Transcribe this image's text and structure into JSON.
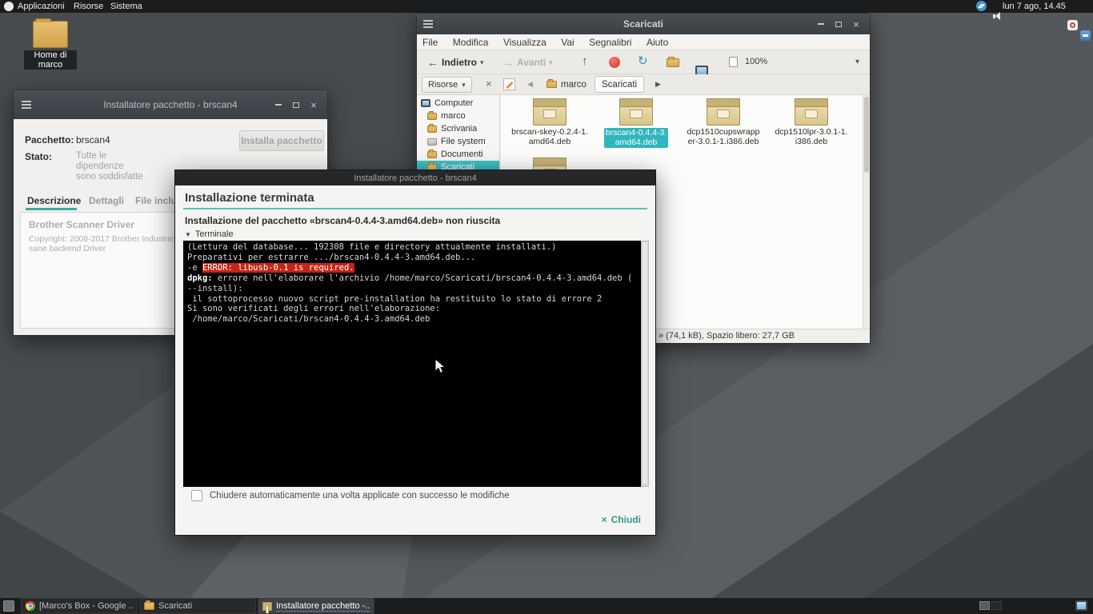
{
  "icons": {
    "back": "←",
    "forward": "→",
    "up": "↑",
    "refresh": "↻",
    "caret": "▾",
    "prev": "◀",
    "next": "▶",
    "expander": "▼",
    "close": "×"
  },
  "top_panel": {
    "menus": [
      "Applicazioni",
      "Risorse",
      "Sistema"
    ],
    "clock": "lun 7 ago, 14.45"
  },
  "desktop": {
    "home_label": "Home di marco"
  },
  "fm": {
    "title": "Scaricati",
    "menus": [
      "File",
      "Modifica",
      "Visualizza",
      "Vai",
      "Segnalibri",
      "Aiuto"
    ],
    "toolbar": {
      "back": "Indietro",
      "forward": "Avanti",
      "zoom": "100%"
    },
    "pathbar": {
      "places": "Risorse",
      "folder": "marco",
      "current": "Scaricati"
    },
    "sidebar": {
      "root": "Computer",
      "items": [
        "marco",
        "Scrivania",
        "File system",
        "Documenti",
        "Scaricati"
      ]
    },
    "files": [
      {
        "line1": "brscan-skey-0.2.4-1.",
        "line2": "amd64.deb"
      },
      {
        "line1": "brscan4-0.4.4-3.",
        "line2": "amd64.deb"
      },
      {
        "line1": "dcp1510cupswrapp",
        "line2": "er-3.0.1-1.i386.deb"
      },
      {
        "line1": "dcp1510lpr-3.0.1-1.",
        "line2": "i386.deb"
      }
    ],
    "status": "» (74,1 kB), Spazio libero: 27,7 GB"
  },
  "inst": {
    "title": "Installatore pacchetto - brscan4",
    "package_label": "Pacchetto:",
    "package_value": "brscan4",
    "install_button": "Installa pacchetto",
    "status_label": "Stato:",
    "status_value": "Tutte le dipendenze sono soddisfatte",
    "tabs": [
      "Descrizione",
      "Dettagli",
      "File inclusi"
    ],
    "desc_title": "Brother Scanner Driver",
    "desc_copyright": "Copyright: 2008-2017 Brother Industries,",
    "desc_line": "sane backend Driver"
  },
  "dlg": {
    "title": "Installatore pacchetto - brscan4",
    "heading": "Installazione terminata",
    "message": "Installazione del pacchetto «brscan4-0.4.4-3.amd64.deb» non riuscita",
    "terminal_label": "Terminale",
    "term": {
      "l1": "(Lettura del database... 192308 file e directory attualmente installati.)",
      "l2": "Preparativi per estrarre .../brscan4-0.4.4-3.amd64.deb...",
      "l3_prefix": "-e ",
      "l3_error": "ERROR: libusb-0.1 is required.",
      "l4_bold": "dpkg:",
      "l4_rest": " errore nell'elaborare l'archivio /home/marco/Scaricati/brscan4-0.4.4-3.amd64.deb (",
      "l5": "--install):",
      "l6": " il sottoprocesso nuovo script pre-installation ha restituito lo stato di errore 2",
      "l7": "Si sono verificati degli errori nell'elaborazione:",
      "l8": " /home/marco/Scaricati/brscan4-0.4.4-3.amd64.deb"
    },
    "checkbox_label": "Chiudere automaticamente una volta applicate con successo le modifiche",
    "close_label": "Chiudi"
  },
  "taskbar": {
    "windows": [
      {
        "title": "[Marco's Box - Google ..."
      },
      {
        "title": "Scaricati"
      },
      {
        "title": "Installatore pacchetto -..."
      }
    ]
  }
}
